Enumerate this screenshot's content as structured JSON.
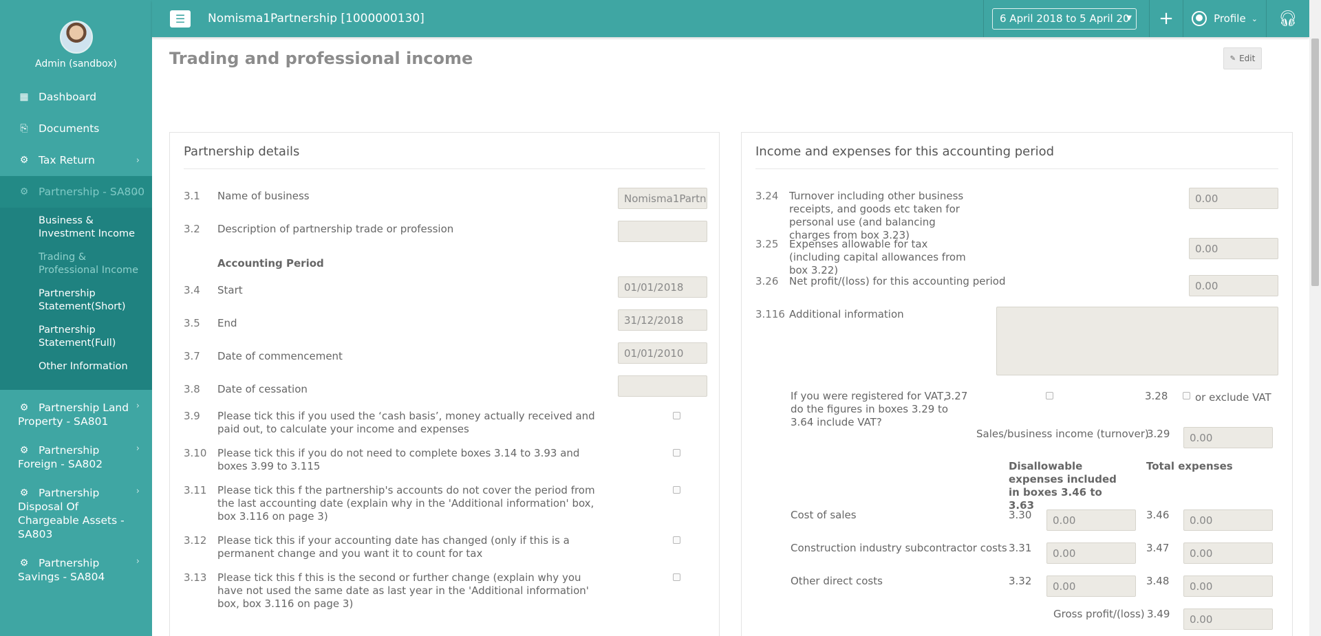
{
  "sidebar": {
    "user_name": "Admin (sandbox)",
    "items": [
      {
        "label": "Dashboard",
        "icon": "dashboard-icon"
      },
      {
        "label": "Documents",
        "icon": "documents-icon"
      },
      {
        "label": "Tax Return",
        "icon": "gears-icon"
      },
      {
        "label": "Partnership - SA800",
        "icon": "gears-icon"
      }
    ],
    "submenu": [
      "Business & Investment Income",
      "Trading & Professional Income",
      "Partnership Statement(Short)",
      "Partnership Statement(Full)",
      "Other Information"
    ],
    "more_items": [
      "Partnership Land Property - SA801",
      "Partnership Foreign - SA802",
      "Partnership Disposal Of Chargeable Assets - SA803",
      "Partnership Savings - SA804"
    ]
  },
  "header": {
    "title": "Nomisma1Partnership [1000000130]",
    "date_range": "6 April 2018 to 5 April 20",
    "profile_label": "Profile"
  },
  "page": {
    "title": "Trading and professional income",
    "edit_label": "Edit"
  },
  "left_panel": {
    "title": "Partnership details",
    "rows": [
      {
        "num": "3.1",
        "label": "Name of business",
        "value": "Nomisma1Partn"
      },
      {
        "num": "3.2",
        "label": "Description of partnership trade or profession",
        "value": ""
      },
      {
        "num": "",
        "label": "Accounting Period"
      },
      {
        "num": "3.4",
        "label": "Start",
        "value": "01/01/2018"
      },
      {
        "num": "3.5",
        "label": "End",
        "value": "31/12/2018"
      },
      {
        "num": "3.7",
        "label": "Date of commencement",
        "value": "01/01/2010"
      },
      {
        "num": "3.8",
        "label": "Date of cessation",
        "value": ""
      },
      {
        "num": "3.9",
        "label": "Please tick this if you used the ‘cash basis’, money actually received and paid out, to calculate your income and expenses"
      },
      {
        "num": "3.10",
        "label": "Please tick this if you do not need to complete boxes 3.14 to 3.93 and boxes 3.99 to 3.115"
      },
      {
        "num": "3.11",
        "label": "Please tick this f the partnership's accounts do not cover the period from the last accounting date (explain why in the 'Additional information' box, box 3.116 on page 3)"
      },
      {
        "num": "3.12",
        "label": "Please tick this if your accounting date has changed (only if this is a permanent change and you want it to count for tax"
      },
      {
        "num": "3.13",
        "label": "Please tick this f this is the second or further change (explain why you have not used the same date as last year in the 'Additional information' box, box 3.116 on page 3)"
      }
    ]
  },
  "right_panel": {
    "title": "Income and expenses for this accounting period",
    "rows": [
      {
        "num": "3.24",
        "label": "Turnover including other business receipts, and goods etc taken for personal use (and balancing charges from box 3.23)",
        "value": "0.00"
      },
      {
        "num": "3.25",
        "label": "Expenses allowable for tax (including capital allowances from box 3.22)",
        "value": "0.00"
      },
      {
        "num": "3.26",
        "label": "Net profit/(loss) for this accounting period",
        "value": "0.00"
      },
      {
        "num": "3.116",
        "label": "Additional information"
      }
    ],
    "vat_question": "If you were registered for VAT, do the figures in boxes 3.29 to 3.64 include VAT?",
    "vat_num_1": "3.27",
    "vat_num_2": "3.28",
    "vat_exclude": "or exclude VAT",
    "sales_label": "Sales/business income (turnover)",
    "sales_num": "3.29",
    "sales_value": "0.00",
    "col_disallowable": "Disallowable expenses included in boxes 3.46 to 3.63",
    "col_total": "Total expenses",
    "expenses": [
      {
        "label": "Cost of sales",
        "num1": "3.30",
        "v1": "0.00",
        "num2": "3.46",
        "v2": "0.00"
      },
      {
        "label": "Construction industry subcontractor costs",
        "num1": "3.31",
        "v1": "0.00",
        "num2": "3.47",
        "v2": "0.00"
      },
      {
        "label": "Other direct costs",
        "num1": "3.32",
        "v1": "0.00",
        "num2": "3.48",
        "v2": "0.00"
      }
    ],
    "gross_label": "Gross profit/(loss)",
    "gross_num": "3.49",
    "gross_value": "0.00"
  }
}
